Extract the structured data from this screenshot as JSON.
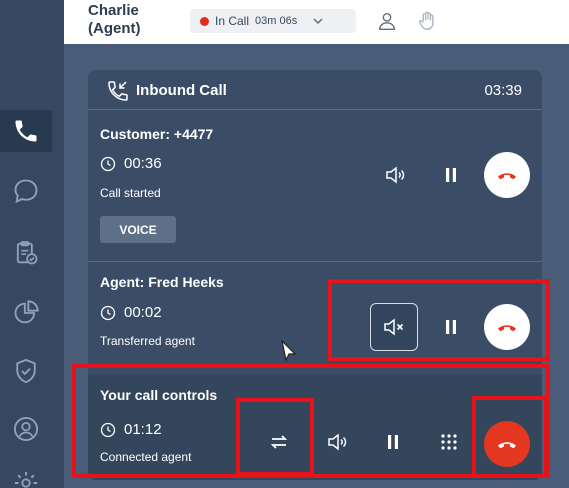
{
  "header": {
    "agent_name": "Charlie (Agent)",
    "status_label": "In Call",
    "status_time": "03m 06s",
    "status_color": "#e02b1d"
  },
  "sidebar": {
    "items": [
      {
        "icon": "phone-icon",
        "active": true
      },
      {
        "icon": "chat-icon",
        "active": false
      },
      {
        "icon": "clipboard-check-icon",
        "active": false
      },
      {
        "icon": "pie-chart-icon",
        "active": false
      },
      {
        "icon": "shield-check-icon",
        "active": false
      },
      {
        "icon": "user-circle-icon",
        "active": false
      },
      {
        "icon": "gear-icon",
        "active": false
      }
    ]
  },
  "call": {
    "title": "Inbound Call",
    "timer": "03:39"
  },
  "customer": {
    "title": "Customer: +4477",
    "timer": "00:36",
    "subtitle": "Call started",
    "badge": "VOICE"
  },
  "agent": {
    "title": "Agent: Fred Heeks",
    "timer": "00:02",
    "subtitle": "Transferred agent"
  },
  "controls": {
    "title": "Your call controls",
    "timer": "01:12",
    "subtitle": "Connected agent"
  },
  "colors": {
    "accent_red": "#e4371f",
    "highlight": "#e8131a",
    "card": "#3b4d66",
    "background": "#4a5d78"
  }
}
